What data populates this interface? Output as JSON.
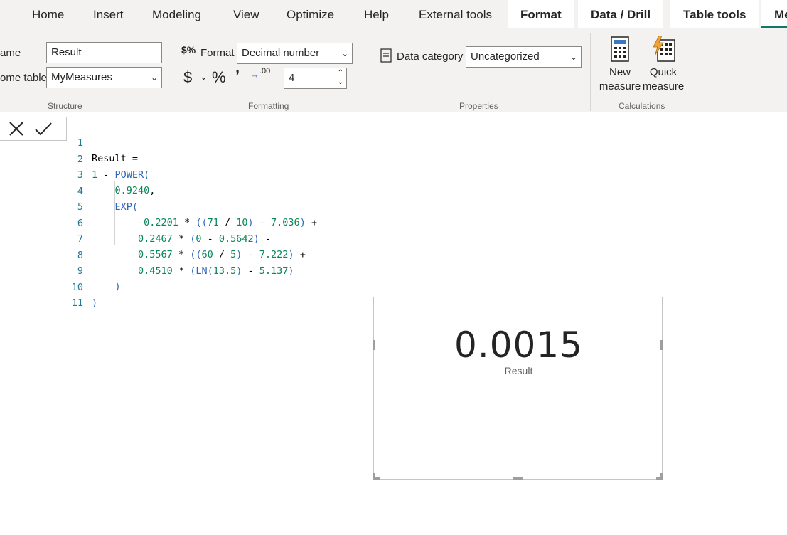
{
  "menu": {
    "tabs": [
      "Home",
      "Insert",
      "Modeling",
      "View",
      "Optimize",
      "Help",
      "External tools"
    ],
    "context_tabs": [
      "Format",
      "Data / Drill",
      "Table tools",
      "Me"
    ]
  },
  "ribbon": {
    "structure": {
      "name_label": "ame",
      "name_value": "Result",
      "home_table_label": "ome table",
      "home_table_value": "MyMeasures",
      "group_label": "Structure"
    },
    "formatting": {
      "format_label": "Format",
      "format_value": "Decimal number",
      "decimals_value": "4",
      "group_label": "Formatting"
    },
    "properties": {
      "data_category_label": "Data category",
      "data_category_value": "Uncategorized",
      "group_label": "Properties"
    },
    "calculations": {
      "new_measure_line1": "New",
      "new_measure_line2": "measure",
      "quick_measure_line1": "Quick",
      "quick_measure_line2": "measure",
      "group_label": "Calculations"
    }
  },
  "formula": {
    "line_numbers": [
      "1",
      "2",
      "3",
      "4",
      "5",
      "6",
      "7",
      "8",
      "9",
      "10",
      "11"
    ]
  },
  "card": {
    "value": "0.0015",
    "label": "Result"
  },
  "colors": {
    "accent": "#117865",
    "keyword": "#3165bb",
    "number": "#098658",
    "line_number": "#237893"
  }
}
